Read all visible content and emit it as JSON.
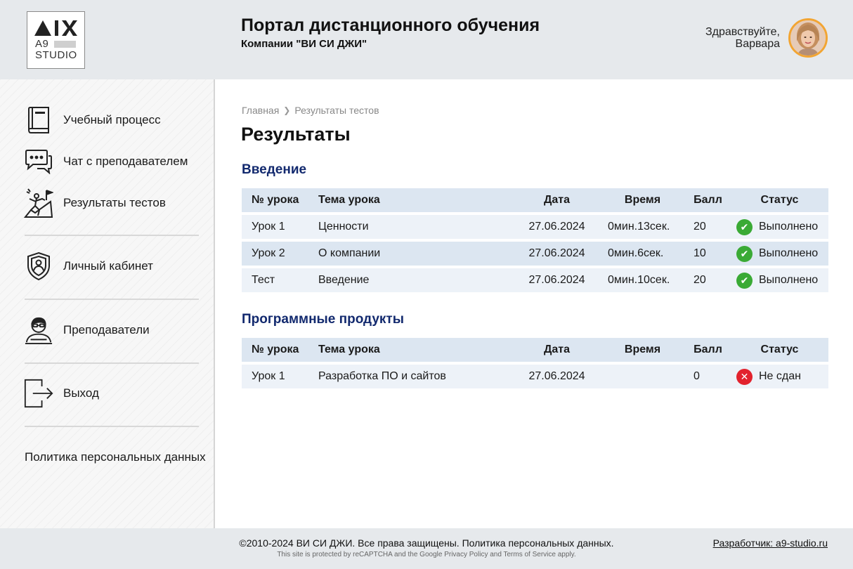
{
  "logo": {
    "line1": "A9",
    "line2": "STUDIO",
    "mark": "AIX"
  },
  "header": {
    "title": "Портал дистанционного обучения",
    "subtitle": "Компании \"ВИ СИ ДЖИ\"",
    "greeting_line1": "Здравствуйте,",
    "greeting_line2": "Варвара"
  },
  "sidebar": {
    "items": [
      {
        "label": "Учебный процесс",
        "icon": "book-icon"
      },
      {
        "label": "Чат с преподавателем",
        "icon": "chat-icon"
      },
      {
        "label": "Результаты тестов",
        "icon": "climber-icon"
      },
      {
        "label": "Личный кабинет",
        "icon": "user-shield-icon"
      },
      {
        "label": "Преподаватели",
        "icon": "teacher-icon"
      },
      {
        "label": "Выход",
        "icon": "exit-icon"
      }
    ],
    "policy": "Политика персональных данных"
  },
  "breadcrumb": {
    "home": "Главная",
    "current": "Результаты тестов"
  },
  "page_title": "Результаты",
  "columns": {
    "num": "№ урока",
    "topic": "Тема урока",
    "date": "Дата",
    "time": "Время",
    "score": "Балл",
    "status": "Статус"
  },
  "sections": [
    {
      "title": "Введение",
      "rows": [
        {
          "num": "Урок 1",
          "topic": "Ценности",
          "date": "27.06.2024",
          "time": "0мин.13сек.",
          "score": "20",
          "status": "Выполнено",
          "passed": true
        },
        {
          "num": "Урок 2",
          "topic": "О компании",
          "date": "27.06.2024",
          "time": "0мин.6сек.",
          "score": "10",
          "status": "Выполнено",
          "passed": true
        },
        {
          "num": "Тест",
          "topic": "Введение",
          "date": "27.06.2024",
          "time": "0мин.10сек.",
          "score": "20",
          "status": "Выполнено",
          "passed": true
        }
      ]
    },
    {
      "title": "Программные продукты",
      "rows": [
        {
          "num": "Урок 1",
          "topic": "Разработка ПО и сайтов",
          "date": "27.06.2024",
          "time": "",
          "score": "0",
          "status": "Не сдан",
          "passed": false
        }
      ]
    }
  ],
  "footer": {
    "copyright": "©2010-2024 ВИ СИ ДЖИ. Все права защищены. Политика персональных данных.",
    "recaptcha": "This site is protected by reCAPTCHA and the Google Privacy Policy and Terms of Service apply.",
    "developer": "Разработчик: a9-studio.ru"
  },
  "colors": {
    "accent": "#12296e",
    "success": "#3aaa35",
    "fail": "#e2222d",
    "avatar_ring": "#f2a533"
  }
}
